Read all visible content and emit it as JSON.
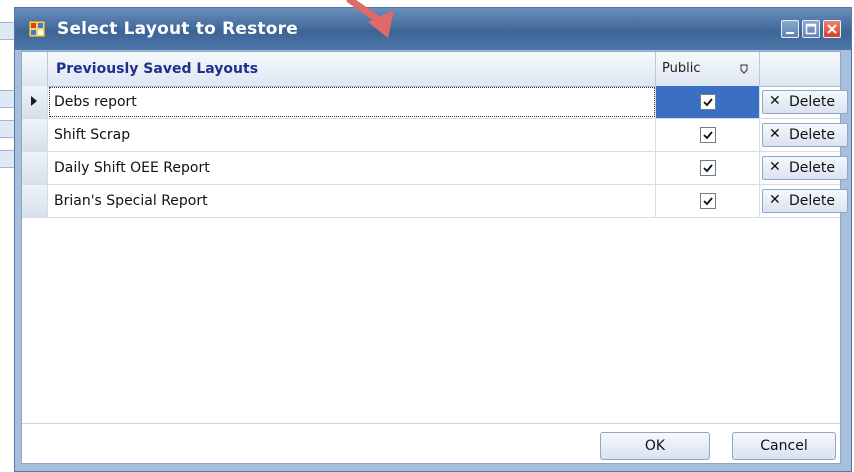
{
  "dialog": {
    "title": "Select Layout to Restore",
    "window_controls": [
      "minimize-icon",
      "maximize-icon",
      "close-icon"
    ]
  },
  "grid": {
    "columns": {
      "name": "Previously Saved Layouts",
      "public": "Public"
    },
    "rows": [
      {
        "name": "Debs report",
        "public": true,
        "action": "Delete"
      },
      {
        "name": "Shift Scrap",
        "public": true,
        "action": "Delete"
      },
      {
        "name": "Daily Shift OEE Report",
        "public": true,
        "action": "Delete"
      },
      {
        "name": "Brian's Special Report",
        "public": true,
        "action": "Delete"
      }
    ]
  },
  "buttons": {
    "ok": "OK",
    "cancel": "Cancel"
  },
  "colors": {
    "titlebar": "#456d9f",
    "header_text": "#1f2f8f",
    "selected_cell": "#3a6fc4",
    "annotation_arrow": "#e06a6a"
  }
}
